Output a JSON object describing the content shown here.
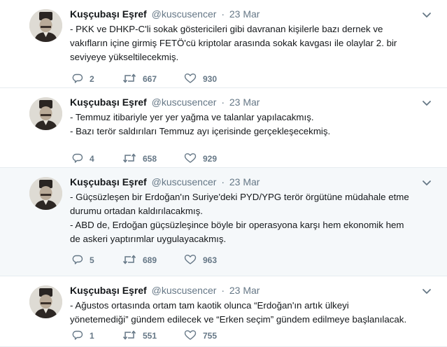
{
  "tweets": [
    {
      "name": "Kuşçubaşı Eşref",
      "handle": "@kuscusencer",
      "separator": "·",
      "time": "23 Mar",
      "lines": [
        "- PKK ve DHKP-C'li sokak göstericileri gibi davranan kişilerle bazı dernek ve",
        "vakıfların içine girmiş FETÖ'cü kriptolar arasında sokak kavgası ile olaylar 2. bir",
        "seviyeye yükseltilecekmiş."
      ],
      "replies": "2",
      "retweets": "667",
      "likes": "930"
    },
    {
      "name": "Kuşçubaşı Eşref",
      "handle": "@kuscusencer",
      "separator": "·",
      "time": "23 Mar",
      "lines": [
        "- Temmuz itibariyle yer yer yağma ve talanlar yapılacakmış.",
        "- Bazı terör saldırıları Temmuz ayı içerisinde gerçekleşecekmiş."
      ],
      "replies": "4",
      "retweets": "658",
      "likes": "929"
    },
    {
      "name": "Kuşçubaşı Eşref",
      "handle": "@kuscusencer",
      "separator": "·",
      "time": "23 Mar",
      "lines": [
        "- Güçsüzleşen bir Erdoğan'ın Suriye'deki PYD/YPG terör örgütüne müdahale etme",
        "durumu ortadan kaldırılacakmış.",
        "- ABD de, Erdoğan güçsüzleşince böyle bir operasyona karşı hem ekonomik hem",
        "de askeri yaptırımlar uygulayacakmış."
      ],
      "replies": "5",
      "retweets": "689",
      "likes": "963"
    },
    {
      "name": "Kuşçubaşı Eşref",
      "handle": "@kuscusencer",
      "separator": "·",
      "time": "23 Mar",
      "lines": [
        "- Ağustos ortasında ortam tam kaotik olunca “Erdoğan'ın artık ülkeyi",
        "yönetemediği” gündem edilecek ve “Erken seçim” gündem edilmeye başlanılacak."
      ],
      "replies": "1",
      "retweets": "551",
      "likes": "755"
    }
  ],
  "colors": {
    "text": "#14171a",
    "secondary": "#657786",
    "border": "#e6ecf0",
    "hover_bg": "#f5f8fa"
  },
  "icons": {
    "avatar": "avatar",
    "more": "chevron-down-icon",
    "reply": "reply-icon",
    "retweet": "retweet-icon",
    "like": "heart-icon"
  }
}
